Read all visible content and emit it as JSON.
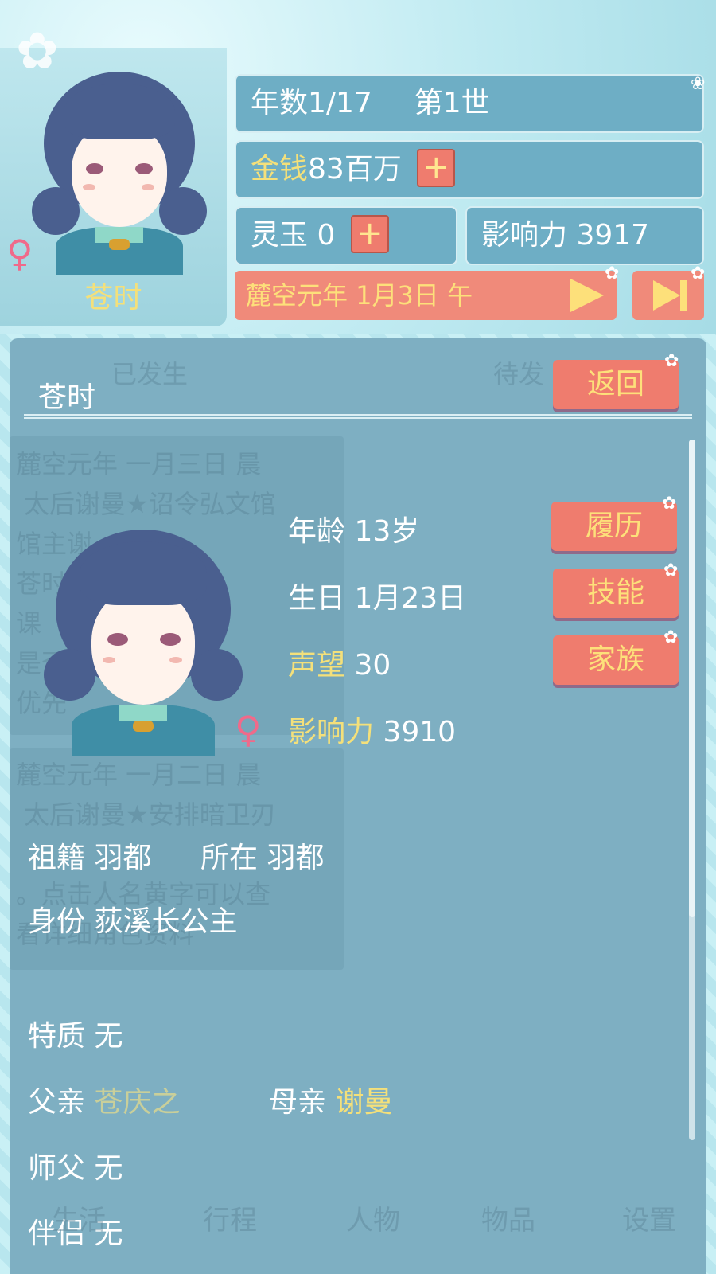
{
  "header": {
    "year_label": "年数1/17",
    "life_label": "第1世",
    "money_label": "金钱",
    "money_value": "83百万",
    "plus_symbol": "+",
    "jade_label": "灵玉 0",
    "influence_label": "影响力 3917",
    "date": "麓空元年 1月3日 午"
  },
  "portrait": {
    "name": "苍时",
    "gender_symbol": "♀",
    "flower_symbol": "✿"
  },
  "panel": {
    "title": "苍时",
    "back_label": "返回",
    "ghost_tab_left": "已发生",
    "ghost_tab_right": "待发",
    "ghost_text_1": "麓空元年 一月三日 晨",
    "ghost_text_2": "太后谢曼★诏令弘文馆",
    "ghost_text_3": "馆主谢",
    "ghost_text_4": "苍时",
    "ghost_text_5": "课",
    "ghost_text_6": "是否",
    "ghost_text_7": "优先",
    "ghost_text_8": "麓空元年 一月二日 晨",
    "ghost_text_9": "太后谢曼★安排暗卫刃",
    "ghost_text_10": "。点击人名黄字可以查",
    "ghost_text_11": "看详细角色资料"
  },
  "profile": {
    "age": "年龄 13岁",
    "birthday": "生日 1月23日",
    "reputation_label": "声望",
    "reputation_value": "30",
    "influence_label": "影响力",
    "influence_value": "3910",
    "resume_button": "履历",
    "skills_button": "技能",
    "family_button": "家族",
    "origin": "祖籍 羽都",
    "location": "所在 羽都",
    "identity": "身份 荻溪长公主",
    "trait": "特质 无",
    "father_label": "父亲",
    "father_name": "苍庆之",
    "mother_label": "母亲",
    "mother_name": "谢曼",
    "master": "师父 无",
    "partner": "伴侣 无"
  },
  "bottom_nav": {
    "items": [
      "生活",
      "行程",
      "人物",
      "物品",
      "设置"
    ]
  },
  "colors": {
    "panel": "#7eafc2",
    "button": "#ef7c6e",
    "gold_text": "#f4e07a",
    "background": "#c9f0f5"
  }
}
